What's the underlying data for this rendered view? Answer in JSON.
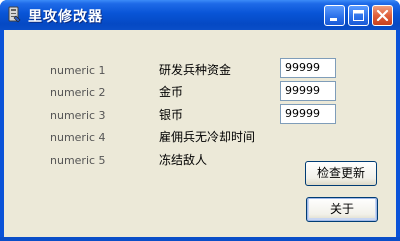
{
  "window": {
    "title": "里攻修改器"
  },
  "titlebar_buttons": {
    "minimize_icon": "minimize-icon",
    "maximize_icon": "maximize-icon",
    "close_icon": "close-icon"
  },
  "rows": [
    {
      "label": "numeric 1",
      "description": "研发兵种资金",
      "value": "99999"
    },
    {
      "label": "numeric 2",
      "description": "金币",
      "value": "99999"
    },
    {
      "label": "numeric 3",
      "description": "银币",
      "value": "99999"
    },
    {
      "label": "numeric 4",
      "description": "雇佣兵无冷却时间"
    },
    {
      "label": "numeric 5",
      "description": "冻结敌人"
    }
  ],
  "buttons": {
    "check_update": "检查更新",
    "about": "关于"
  },
  "colors": {
    "titlebar": "#0854d6",
    "client_bg": "#ece9d8",
    "close_button": "#e0603c"
  }
}
